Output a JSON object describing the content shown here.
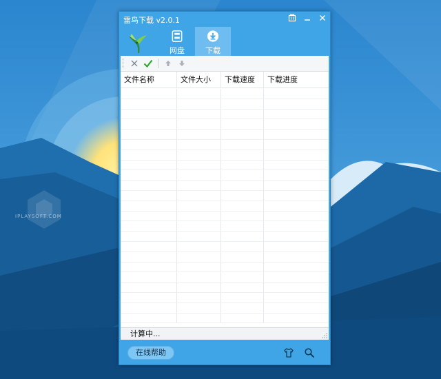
{
  "app": {
    "title": "雷鸟下载  v2.0.1"
  },
  "window_controls": {
    "icons": [
      "skin-icon",
      "minimize-icon",
      "close-icon"
    ]
  },
  "tabs": [
    {
      "label": "网盘",
      "icon": "disk-icon",
      "active": false
    },
    {
      "label": "下载",
      "icon": "download-icon",
      "active": true
    }
  ],
  "toolbar": {
    "icons": [
      "delete-icon",
      "confirm-icon",
      "move-up-icon",
      "move-down-icon"
    ]
  },
  "list": {
    "columns": [
      "文件名称",
      "文件大小",
      "下载速度",
      "下载进度"
    ],
    "rows": []
  },
  "status": {
    "text": "计算中..."
  },
  "footer": {
    "help_label": "在线帮助",
    "icons": [
      "shirt-icon",
      "search-icon"
    ]
  },
  "desktop": {
    "watermark": "IPLAYSOFT.COM"
  },
  "colors": {
    "window_blue": "#3fa5e6",
    "active_tab": "#6fbdf0",
    "confirm_green": "#2aa82a"
  }
}
